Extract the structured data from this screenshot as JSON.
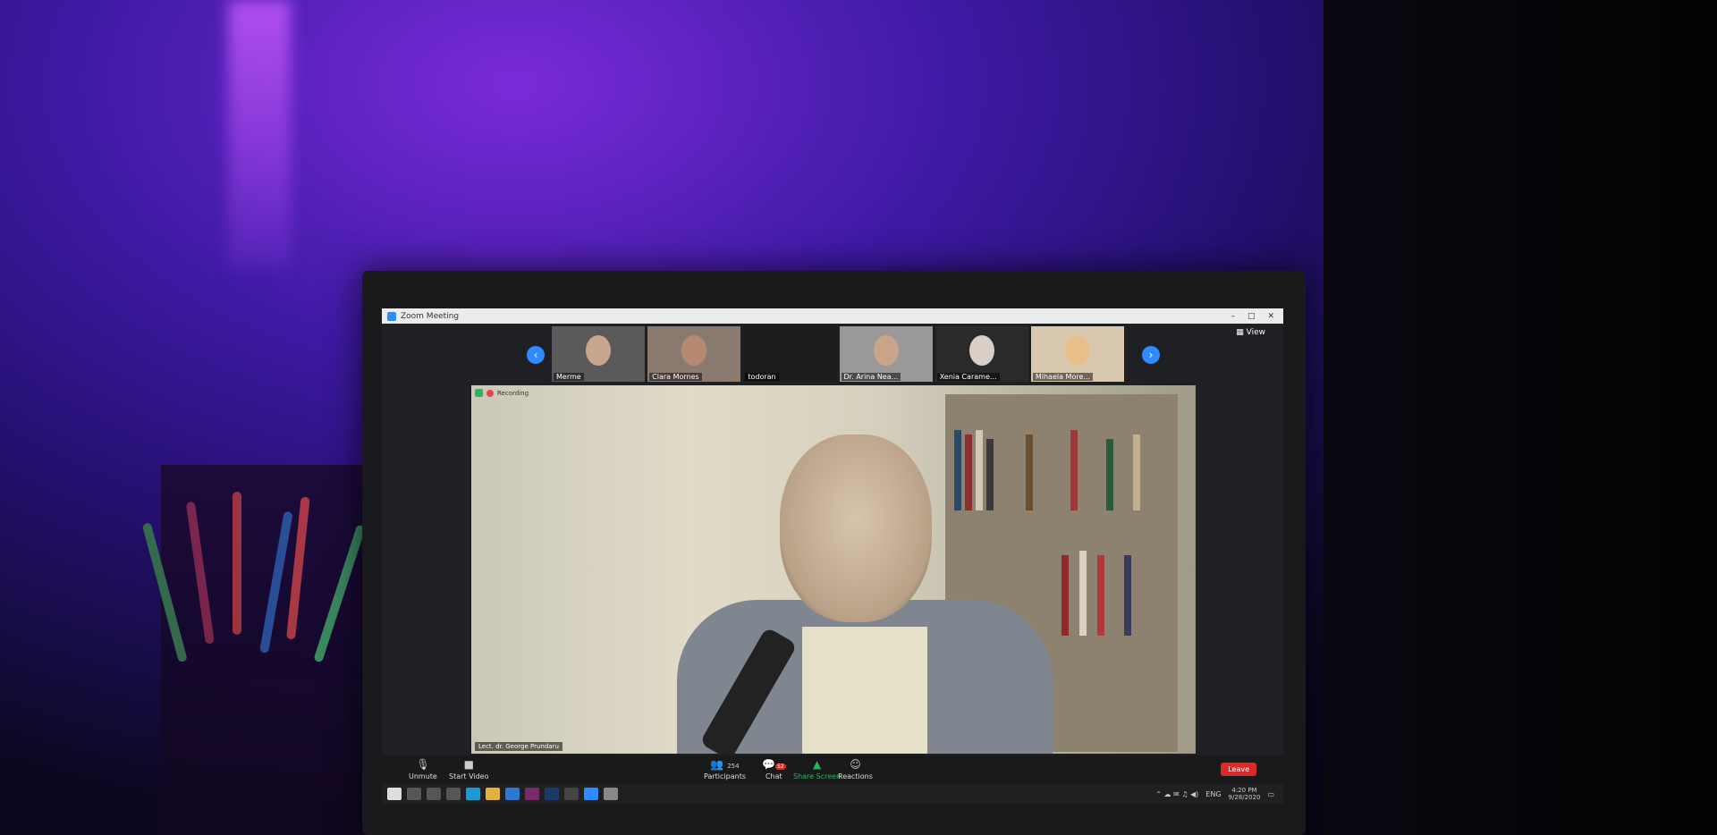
{
  "window": {
    "title": "Zoom Meeting",
    "view_label": "View"
  },
  "gallery": {
    "participants": [
      {
        "name": "Merme"
      },
      {
        "name": "Clara Mornes"
      },
      {
        "name": "todoran"
      },
      {
        "name": "Dr. Arina Nea..."
      },
      {
        "name": "Xenia Carame..."
      },
      {
        "name": "Mihaela More..."
      }
    ]
  },
  "main_video": {
    "recording_label": "Recording",
    "speaker": "Lect. dr. George Prundaru"
  },
  "toolbar": {
    "unmute": "Unmute",
    "start_video": "Start Video",
    "participants": "Participants",
    "participant_count": "254",
    "chat": "Chat",
    "chat_badge": "52",
    "share_screen": "Share Screen",
    "reactions": "Reactions",
    "leave": "Leave"
  },
  "taskbar": {
    "lang": "ENG",
    "time": "4:20 PM",
    "date": "9/28/2020"
  },
  "colors": {
    "zoom_blue": "#2d8cff",
    "leave_red": "#e02828",
    "share_green": "#2db35d"
  }
}
